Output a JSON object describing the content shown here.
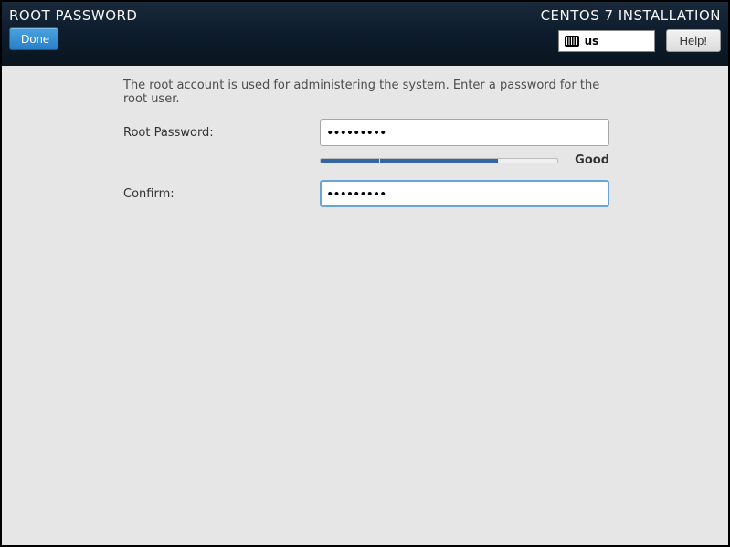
{
  "header": {
    "title": "ROOT PASSWORD",
    "done_label": "Done",
    "installer_title": "CENTOS 7 INSTALLATION",
    "keyboard_layout": "us",
    "help_label": "Help!"
  },
  "form": {
    "description": "The root account is used for administering the system.  Enter a password for the root user.",
    "password_label": "Root Password:",
    "password_value": "•••••••••",
    "confirm_label": "Confirm:",
    "confirm_value": "•••••••••",
    "strength_text": "Good",
    "strength_segments": [
      true,
      true,
      true,
      false
    ]
  }
}
